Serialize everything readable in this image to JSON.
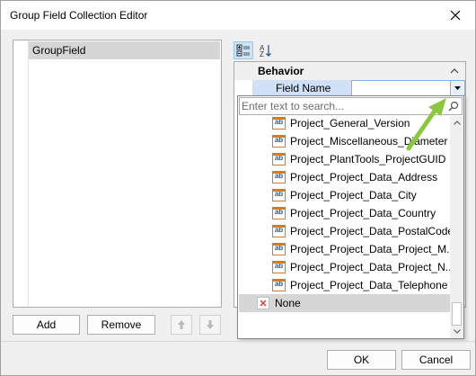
{
  "window": {
    "title": "Group Field Collection Editor"
  },
  "collection": {
    "items": [
      "GroupField"
    ],
    "add_label": "Add",
    "remove_label": "Remove"
  },
  "properties": {
    "category": "Behavior",
    "field_label": "Field Name",
    "field_value": ""
  },
  "dropdown": {
    "search_placeholder": "Enter text to search...",
    "items": [
      "Project_General_Version",
      "Project_Miscellaneous_Diameter",
      "Project_PlantTools_ProjectGUID",
      "Project_Project_Data_Address",
      "Project_Project_Data_City",
      "Project_Project_Data_Country",
      "Project_Project_Data_PostalCode",
      "Project_Project_Data_Project_M...",
      "Project_Project_Data_Project_N...",
      "Project_Project_Data_Telephone"
    ],
    "item_icon_text": "ab",
    "none_label": "None"
  },
  "footer": {
    "ok_label": "OK",
    "cancel_label": "Cancel"
  },
  "colors": {
    "accent": "#7eb4ea",
    "arrow": "#8dc63f",
    "selection": "#d6d6d6",
    "none_icon": "#d83b3b"
  },
  "icons": {
    "close": "close-icon",
    "categorized": "categorized-icon",
    "alphabetical": "sort-alphabetical-icon",
    "search": "search-icon",
    "up": "arrow-up-icon",
    "down": "arrow-down-icon"
  }
}
